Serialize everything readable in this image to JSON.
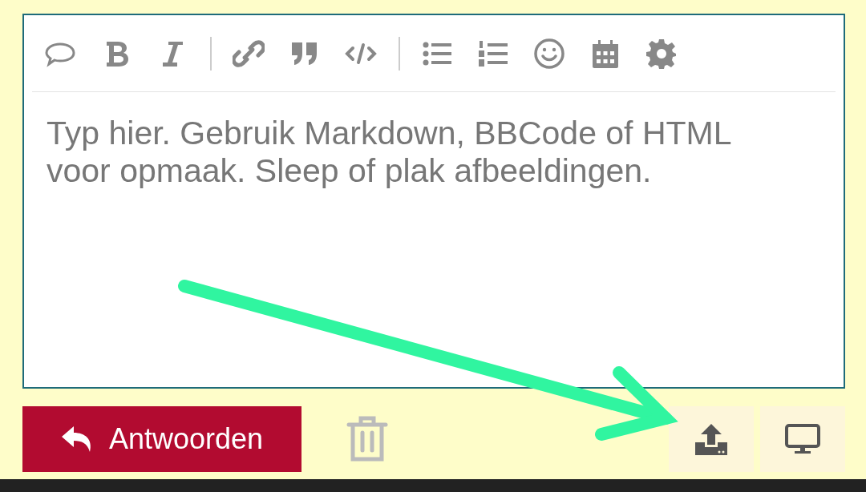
{
  "editor": {
    "placeholder": "Typ hier. Gebruik Markdown, BBCode of HTML voor opmaak. Sleep of plak afbeeldingen."
  },
  "reply_button": {
    "label": "Antwoorden"
  }
}
